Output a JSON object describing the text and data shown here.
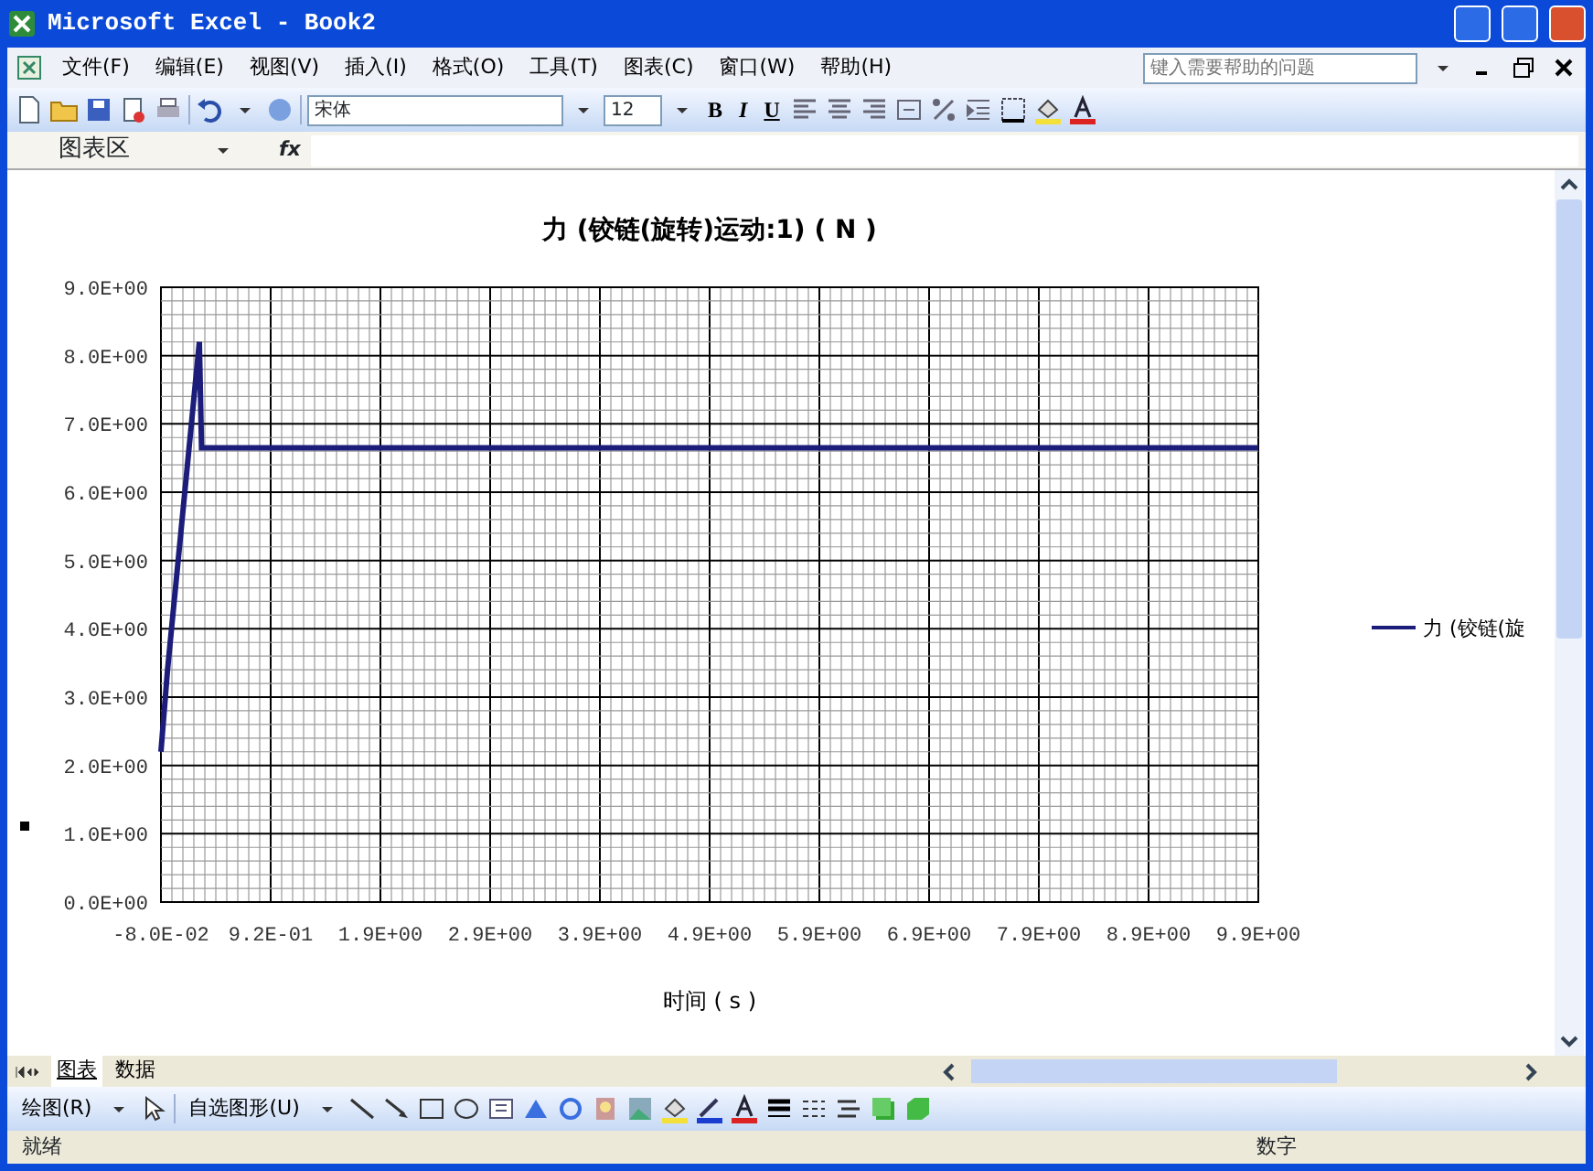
{
  "window": {
    "title": "Microsoft Excel - Book2"
  },
  "menu": [
    "文件(F)",
    "编辑(E)",
    "视图(V)",
    "插入(I)",
    "格式(O)",
    "工具(T)",
    "图表(C)",
    "窗口(W)",
    "帮助(H)"
  ],
  "help_box": {
    "placeholder": "键入需要帮助的问题"
  },
  "format_toolbar": {
    "font": "宋体",
    "size": "12",
    "bold": "B",
    "italic": "I",
    "underline": "U"
  },
  "formula_bar": {
    "name_box": "图表区",
    "fx": "fx"
  },
  "chart": {
    "chart_data": {
      "type": "line",
      "grid": true,
      "title": "力 (铰链(旋转)运动:1) ( N )",
      "xlabel": "时间 ( s )",
      "x": [
        -0.08,
        -0.02,
        0.27,
        0.29,
        9.92
      ],
      "series": [
        {
          "name": "力 (铰链(旋",
          "color": "#1c1c7a",
          "values": [
            2.2,
            3.4,
            8.2,
            6.65,
            6.65
          ]
        }
      ],
      "xlim": [
        -0.08,
        9.92
      ],
      "ylim": [
        0,
        9
      ],
      "xticks": [
        {
          "value": -0.08,
          "label": "-8.0E-02"
        },
        {
          "value": 0.92,
          "label": "9.2E-01"
        },
        {
          "value": 1.92,
          "label": "1.9E+00"
        },
        {
          "value": 2.92,
          "label": "2.9E+00"
        },
        {
          "value": 3.92,
          "label": "3.9E+00"
        },
        {
          "value": 4.92,
          "label": "4.9E+00"
        },
        {
          "value": 5.92,
          "label": "5.9E+00"
        },
        {
          "value": 6.92,
          "label": "6.9E+00"
        },
        {
          "value": 7.92,
          "label": "7.9E+00"
        },
        {
          "value": 8.92,
          "label": "8.9E+00"
        },
        {
          "value": 9.92,
          "label": "9.9E+00"
        }
      ],
      "yticks": [
        {
          "value": 0,
          "label": "0.0E+00"
        },
        {
          "value": 1,
          "label": "1.0E+00"
        },
        {
          "value": 2,
          "label": "2.0E+00"
        },
        {
          "value": 3,
          "label": "3.0E+00"
        },
        {
          "value": 4,
          "label": "4.0E+00"
        },
        {
          "value": 5,
          "label": "5.0E+00"
        },
        {
          "value": 6,
          "label": "6.0E+00"
        },
        {
          "value": 7,
          "label": "7.0E+00"
        },
        {
          "value": 8,
          "label": "8.0E+00"
        },
        {
          "value": 9,
          "label": "9.0E+00"
        }
      ]
    }
  },
  "sheet_tabs": [
    {
      "label": "图表",
      "selected": true
    },
    {
      "label": "数据",
      "selected": false
    }
  ],
  "drawing_toolbar": {
    "draw": "绘图(R)",
    "autoshapes": "自选图形(U)"
  },
  "status_bar": {
    "left": "就绪",
    "right": "数字"
  }
}
